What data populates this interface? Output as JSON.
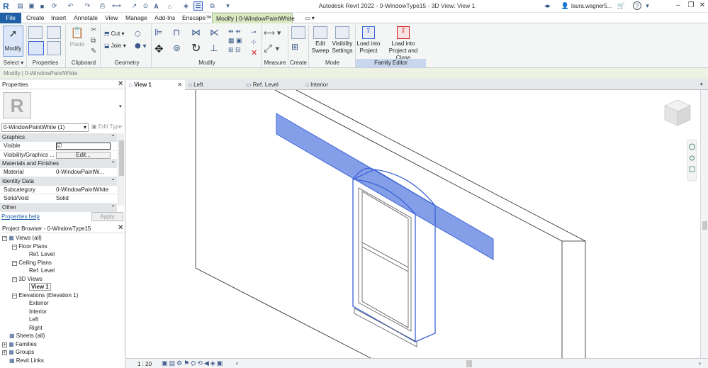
{
  "titlebar": {
    "app_title": "Autodesk Revit 2022 - 0-WindowType15 - 3D View: View 1",
    "user": "laura.wagner5...",
    "logo": "R",
    "help": "?",
    "icons": [
      "revit-logo",
      "open-icon",
      "save-icon",
      "sync-icon",
      "undo-icon",
      "redo-icon",
      "print-icon",
      "measure-icon",
      "text-icon",
      "default-3d-icon",
      "section-icon",
      "thin-lines-icon",
      "close-hidden-icon",
      "switch-windows-icon",
      "customize-qat-icon"
    ]
  },
  "ribbon_tabs": [
    "File",
    "Create",
    "Insert",
    "Annotate",
    "View",
    "Manage",
    "Add-Ins",
    "Enscape™",
    "Modify | 0-WindowPaintWhite"
  ],
  "ribbon": {
    "select": {
      "label": "Select",
      "modify_label": "Modify"
    },
    "properties_label": "Properties",
    "clipboard": {
      "label": "Clipboard",
      "paste": "Paste",
      "cut": "Cut",
      "join": "Join"
    },
    "geometry_label": "Geometry",
    "modify_label": "Modify",
    "measure_label": "Measure",
    "create_label": "Create",
    "mode": {
      "label": "Mode",
      "edit_sweep": "Edit\nSweep",
      "visibility_settings": "Visibility\nSettings"
    },
    "family_editor": {
      "label": "Family Editor",
      "load_into_project": "Load into\nProject",
      "load_close": "Load into\nProject and Close"
    }
  },
  "context_bar": "Modify | 0-WindowPaintWhite",
  "properties": {
    "title": "Properties",
    "logo": "R",
    "type_selector": "0-WindowPaintWhite (1)",
    "edit_type": "Edit Type",
    "groups": [
      {
        "name": "Graphics",
        "rows": [
          {
            "label": "Visible",
            "value": "☑"
          },
          {
            "label": "Visibility/Graphics ...",
            "value": "Edit..."
          }
        ]
      },
      {
        "name": "Materials and Finishes",
        "rows": [
          {
            "label": "Material",
            "value": "0-WindowPaintW..."
          }
        ]
      },
      {
        "name": "Identity Data",
        "rows": [
          {
            "label": "Subcategory",
            "value": "0-WindowPaintWhite"
          },
          {
            "label": "Solid/Void",
            "value": "Solid"
          }
        ]
      },
      {
        "name": "Other",
        "rows": []
      }
    ],
    "help_link": "Properties help",
    "apply": "Apply"
  },
  "browser": {
    "title": "Project Browser - 0-WindowType15",
    "items": [
      {
        "label": "Views (all)",
        "level": 0,
        "exp": "−"
      },
      {
        "label": "Floor Plans",
        "level": 1,
        "exp": "−"
      },
      {
        "label": "Ref. Level",
        "level": 2,
        "exp": ""
      },
      {
        "label": "Ceiling Plans",
        "level": 1,
        "exp": "−"
      },
      {
        "label": "Ref. Level",
        "level": 2,
        "exp": ""
      },
      {
        "label": "3D Views",
        "level": 1,
        "exp": "−"
      },
      {
        "label": "View 1",
        "level": 2,
        "exp": "",
        "bold": true
      },
      {
        "label": "Elevations (Elevation 1)",
        "level": 1,
        "exp": "−"
      },
      {
        "label": "Exterior",
        "level": 2,
        "exp": ""
      },
      {
        "label": "Interior",
        "level": 2,
        "exp": ""
      },
      {
        "label": "Left",
        "level": 2,
        "exp": ""
      },
      {
        "label": "Right",
        "level": 2,
        "exp": ""
      },
      {
        "label": "Sheets (all)",
        "level": 0,
        "exp": ""
      },
      {
        "label": "Families",
        "level": 0,
        "exp": "+"
      },
      {
        "label": "Groups",
        "level": 0,
        "exp": "+"
      },
      {
        "label": "Revit Links",
        "level": 0,
        "exp": ""
      }
    ]
  },
  "view_tabs": [
    "View 1",
    "Left",
    "Ref. Level",
    "Interior"
  ],
  "statusbar": {
    "scale": "1 : 20"
  },
  "colors": {
    "file_tab": "#1f5fa6",
    "context_tab": "#d9e9c4",
    "selection": "#3b63d6",
    "family_editor": "#c8d6ee"
  }
}
